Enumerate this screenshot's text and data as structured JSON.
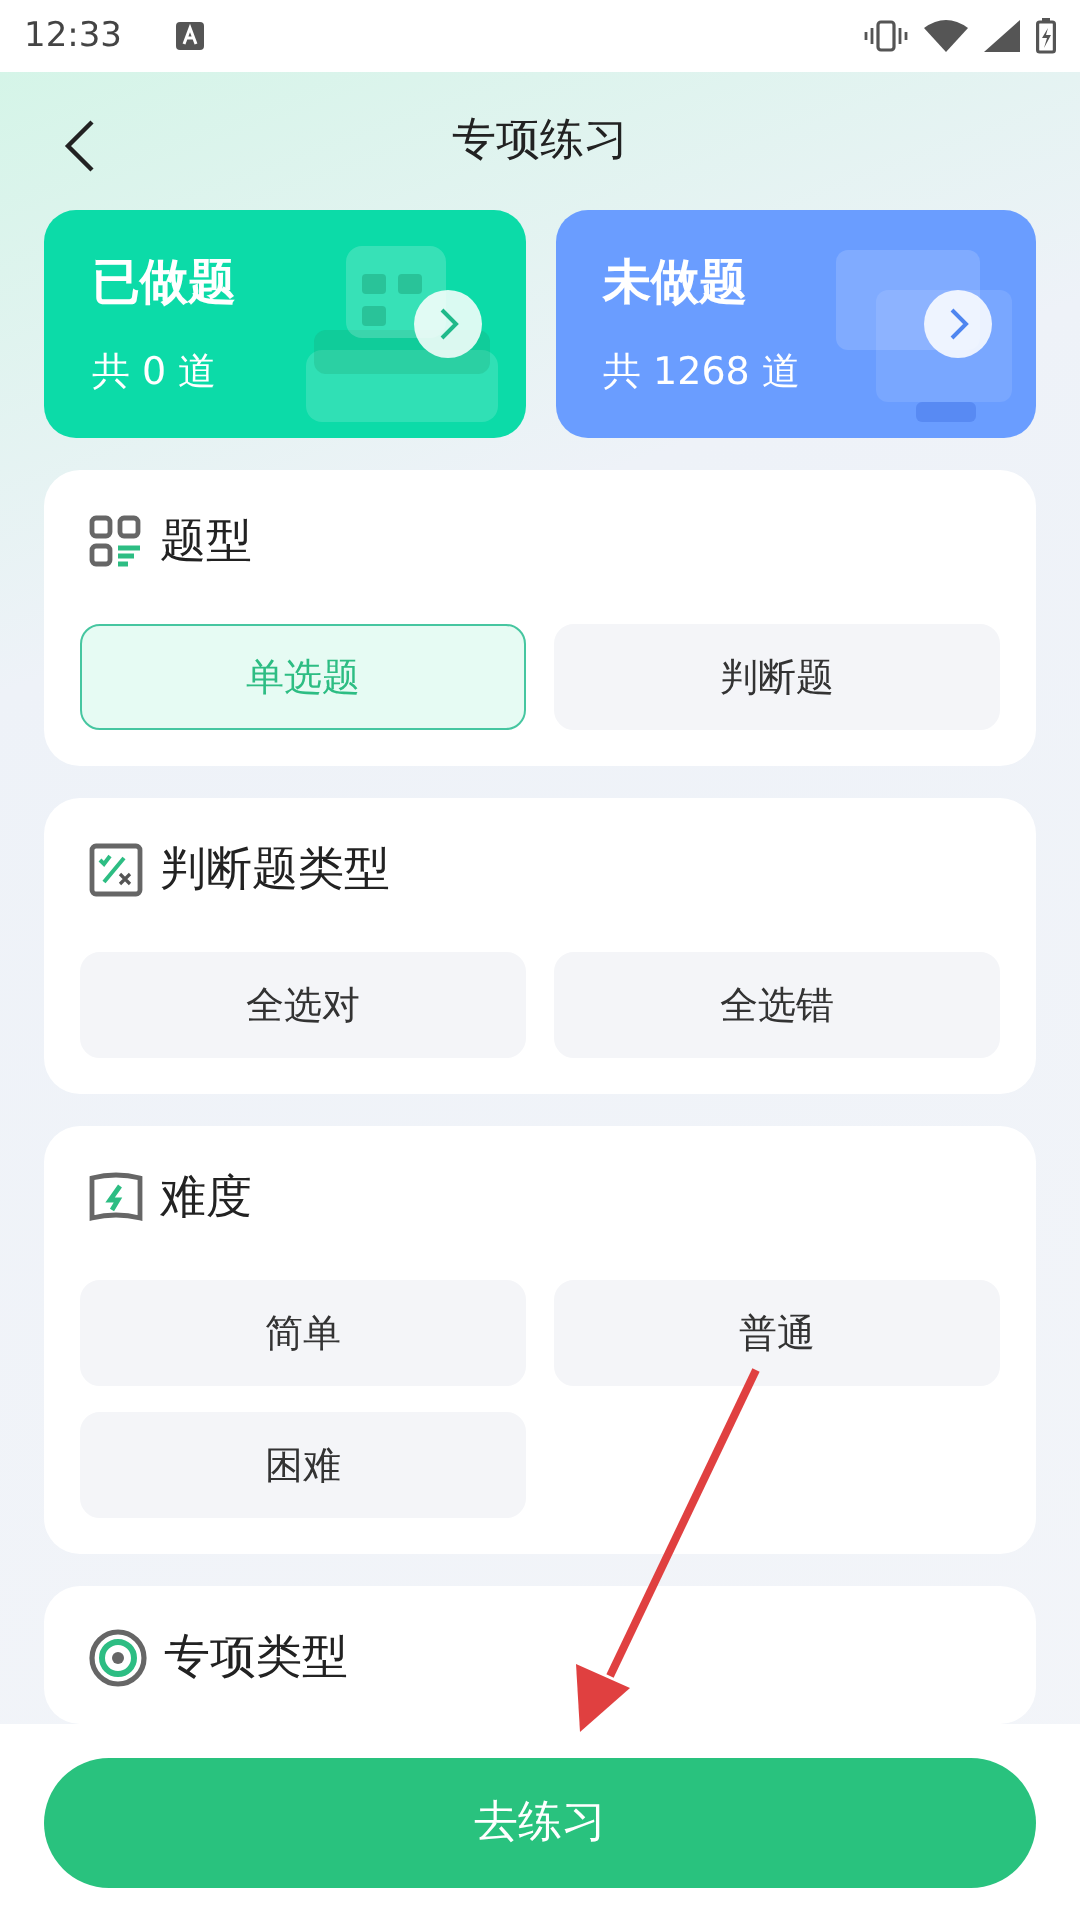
{
  "status_bar": {
    "time": "12:33"
  },
  "header": {
    "title": "专项练习"
  },
  "summary_cards": [
    {
      "kind": "done",
      "title": "已做题",
      "count": "共 0 道"
    },
    {
      "kind": "todo",
      "title": "未做题",
      "count": "共 1268 道"
    }
  ],
  "sections": [
    {
      "kind": "type",
      "title": "题型",
      "options": [
        {
          "label": "单选题",
          "selected": true
        },
        {
          "label": "判断题",
          "selected": false
        }
      ]
    },
    {
      "kind": "judge",
      "title": "判断题类型",
      "options": [
        {
          "label": "全选对",
          "selected": false
        },
        {
          "label": "全选错",
          "selected": false
        }
      ]
    },
    {
      "kind": "difficulty",
      "title": "难度",
      "options": [
        {
          "label": "简单",
          "selected": false
        },
        {
          "label": "普通",
          "selected": false
        },
        {
          "label": "困难",
          "selected": false
        }
      ]
    },
    {
      "kind": "topic",
      "title": "专项类型"
    }
  ],
  "primary_button": {
    "label": "去练习"
  }
}
